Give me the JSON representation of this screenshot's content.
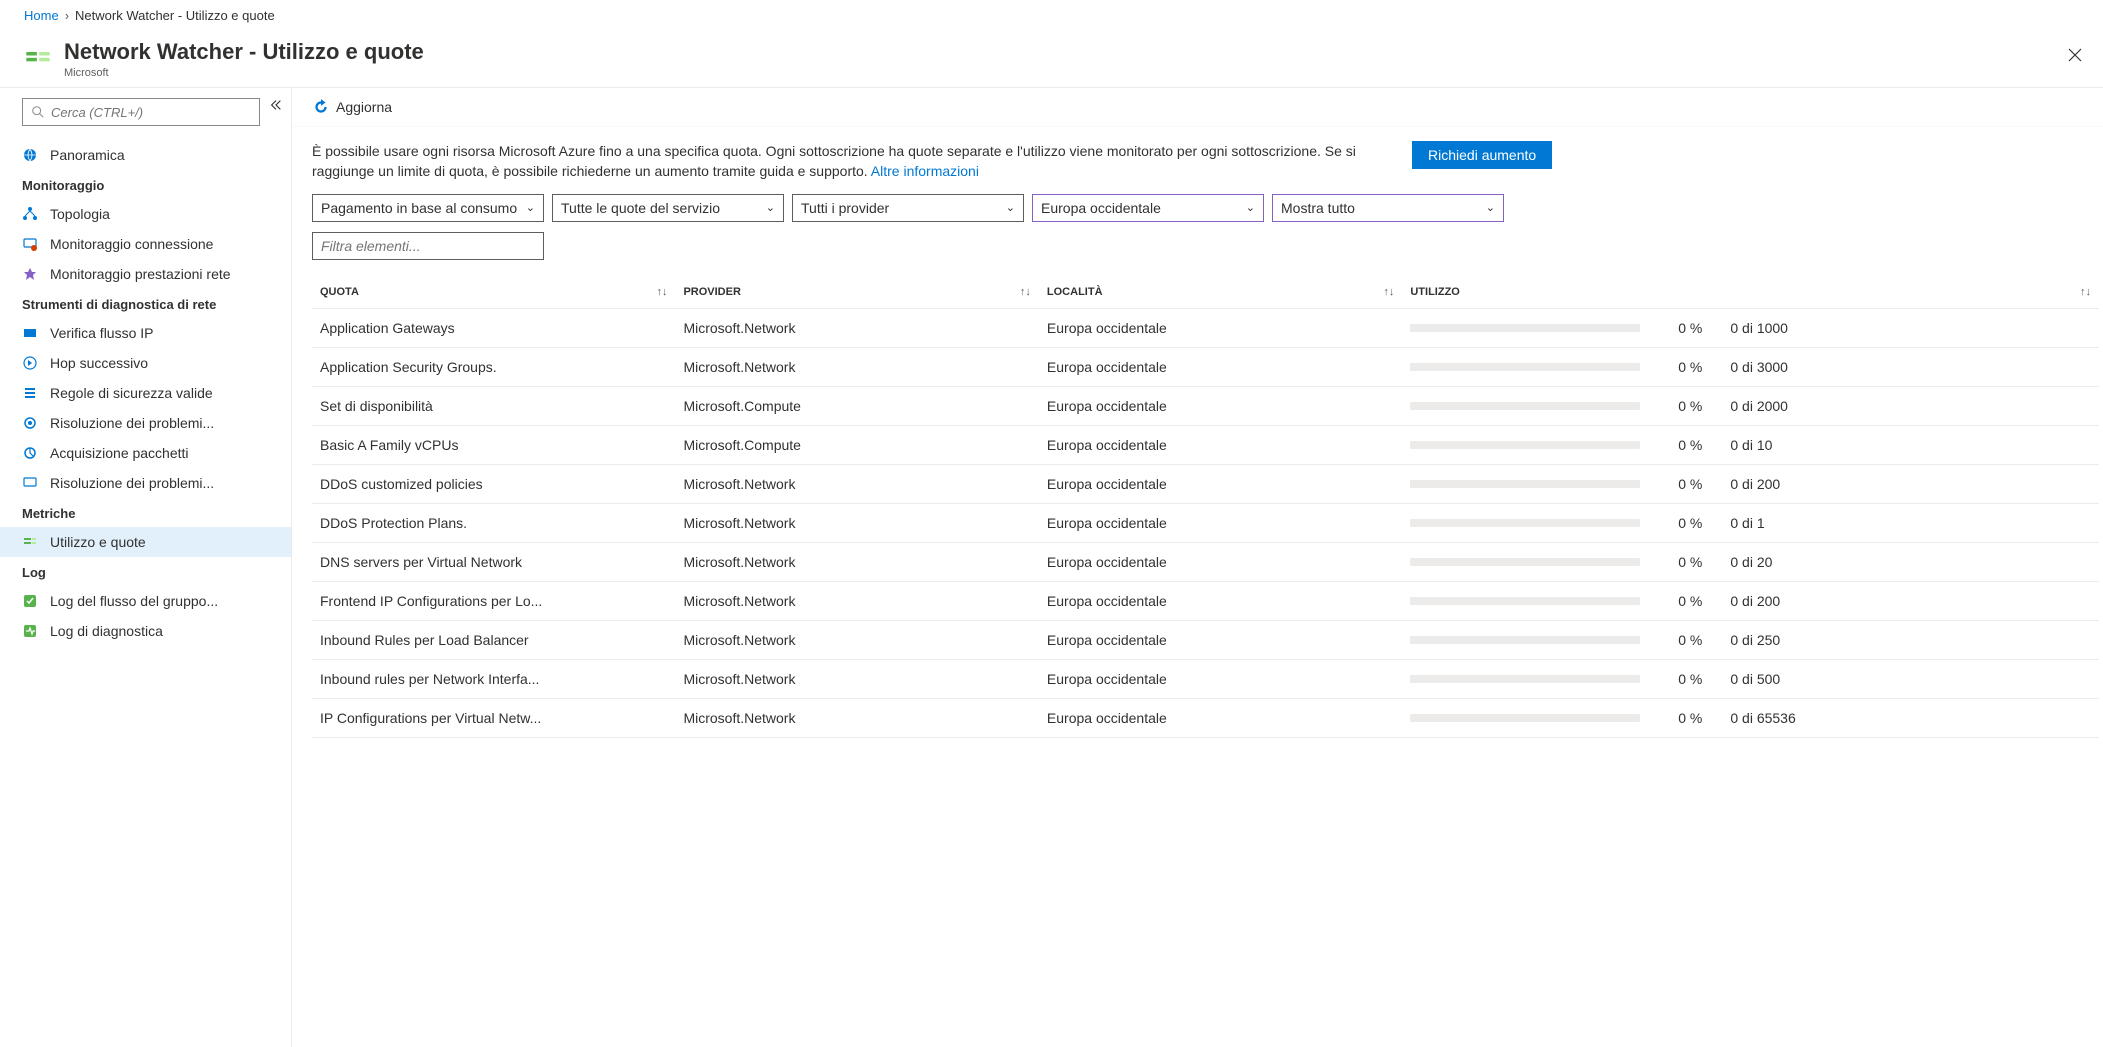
{
  "breadcrumb": {
    "home": "Home",
    "current": "Network Watcher - Utilizzo e quote"
  },
  "header": {
    "title": "Network Watcher - Utilizzo e quote",
    "subtitle": "Microsoft"
  },
  "search": {
    "placeholder": "Cerca (CTRL+/)"
  },
  "sidebar": {
    "overview": "Panoramica",
    "sections": [
      {
        "title": "Monitoraggio",
        "items": [
          "Topologia",
          "Monitoraggio connessione",
          "Monitoraggio prestazioni rete"
        ]
      },
      {
        "title": "Strumenti di diagnostica di rete",
        "items": [
          "Verifica flusso IP",
          "Hop successivo",
          "Regole di sicurezza valide",
          "Risoluzione dei problemi...",
          "Acquisizione pacchetti",
          "Risoluzione dei problemi..."
        ]
      },
      {
        "title": "Metriche",
        "items": [
          "Utilizzo e quote"
        ]
      },
      {
        "title": "Log",
        "items": [
          "Log del flusso del gruppo...",
          "Log di diagnostica"
        ]
      }
    ]
  },
  "toolbar": {
    "refresh": "Aggiorna"
  },
  "info": {
    "text": "È possibile usare ogni risorsa Microsoft Azure fino a una specifica quota. Ogni sottoscrizione ha quote separate e l'utilizzo viene monitorato per ogni sottoscrizione. Se si raggiunge un limite di quota, è possibile richiederne un aumento tramite guida e supporto. ",
    "link": "Altre informazioni",
    "request_button": "Richiedi aumento"
  },
  "filters": {
    "subscription": "Pagamento in base al consumo",
    "quota_scope": "Tutte le quote del servizio",
    "provider": "Tutti i provider",
    "location": "Europa occidentale",
    "show": "Mostra tutto",
    "filter_placeholder": "Filtra elementi..."
  },
  "table": {
    "headers": {
      "quota": "Quota",
      "provider": "Provider",
      "location": "Località",
      "usage": "Utilizzo"
    },
    "rows": [
      {
        "quota": "Application Gateways",
        "provider": "Microsoft.Network",
        "location": "Europa occidentale",
        "pct": "0 %",
        "ratio": "0 di 1000"
      },
      {
        "quota": "Application Security Groups.",
        "provider": "Microsoft.Network",
        "location": "Europa occidentale",
        "pct": "0 %",
        "ratio": "0 di 3000"
      },
      {
        "quota": "Set di disponibilità",
        "provider": "Microsoft.Compute",
        "location": "Europa occidentale",
        "pct": "0 %",
        "ratio": "0 di 2000"
      },
      {
        "quota": "Basic A Family vCPUs",
        "provider": "Microsoft.Compute",
        "location": "Europa occidentale",
        "pct": "0 %",
        "ratio": "0 di 10"
      },
      {
        "quota": "DDoS customized policies",
        "provider": "Microsoft.Network",
        "location": "Europa occidentale",
        "pct": "0 %",
        "ratio": "0 di 200"
      },
      {
        "quota": "DDoS Protection Plans.",
        "provider": "Microsoft.Network",
        "location": "Europa occidentale",
        "pct": "0 %",
        "ratio": "0 di 1"
      },
      {
        "quota": "DNS servers per Virtual Network",
        "provider": "Microsoft.Network",
        "location": "Europa occidentale",
        "pct": "0 %",
        "ratio": "0 di 20"
      },
      {
        "quota": "Frontend IP Configurations per Lo...",
        "provider": "Microsoft.Network",
        "location": "Europa occidentale",
        "pct": "0 %",
        "ratio": "0 di 200"
      },
      {
        "quota": "Inbound Rules per Load Balancer",
        "provider": "Microsoft.Network",
        "location": "Europa occidentale",
        "pct": "0 %",
        "ratio": "0 di 250"
      },
      {
        "quota": "Inbound rules per Network Interfa...",
        "provider": "Microsoft.Network",
        "location": "Europa occidentale",
        "pct": "0 %",
        "ratio": "0 di 500"
      },
      {
        "quota": "IP Configurations per Virtual Netw...",
        "provider": "Microsoft.Network",
        "location": "Europa occidentale",
        "pct": "0 %",
        "ratio": "0 di 65536"
      }
    ]
  }
}
